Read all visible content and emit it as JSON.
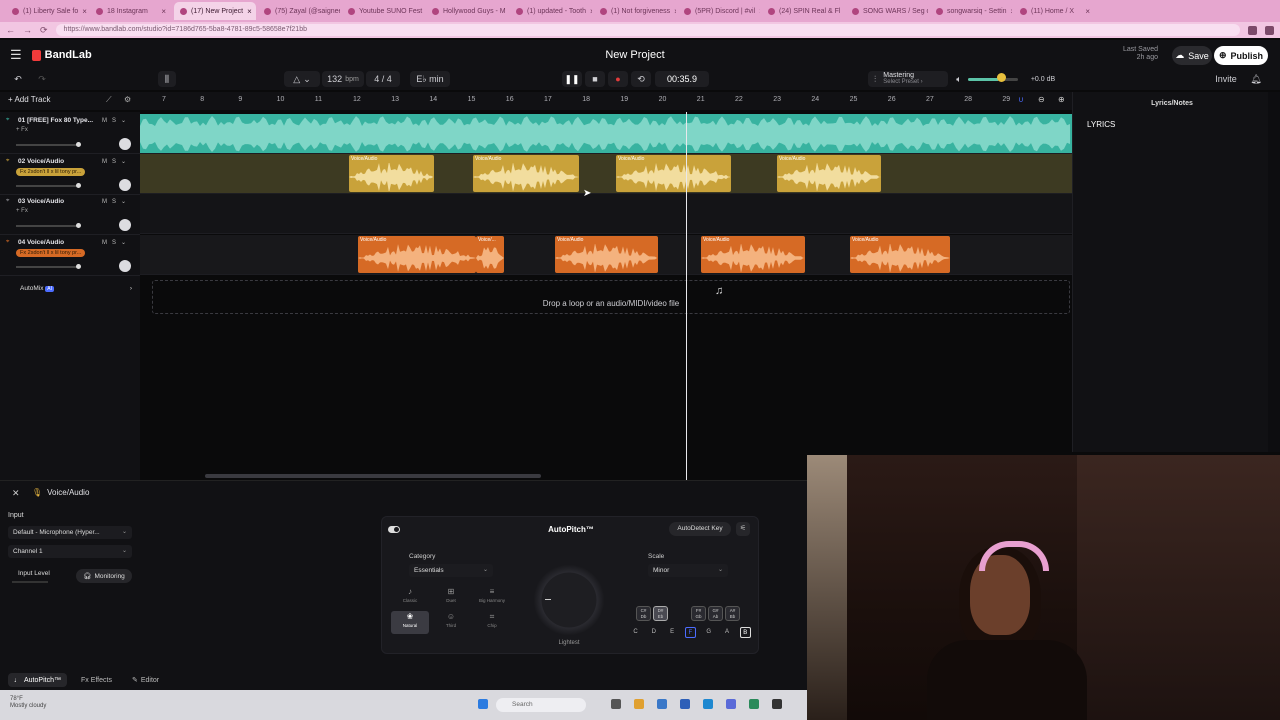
{
  "browser": {
    "tabs": [
      {
        "label": "(1) Liberty Sale fo"
      },
      {
        "label": "18 Instagram"
      },
      {
        "label": "(17) New Project",
        "active": true
      },
      {
        "label": "(75) Zayal (@saignee"
      },
      {
        "label": "Youtube SUNO Fest"
      },
      {
        "label": "Hollywood Guys - M"
      },
      {
        "label": "(1) updated - Tooth"
      },
      {
        "label": "(1) Not forgiveness"
      },
      {
        "label": "(5PR) Discord | #vil"
      },
      {
        "label": "(24) SPIN Real & Fl"
      },
      {
        "label": "SONG WARS / Seg of"
      },
      {
        "label": "songwarsiq - Settin"
      },
      {
        "label": "(11) Home / X"
      }
    ],
    "url": "https://www.bandlab.com/studio?id=7186d765-5ba8-4781-89c5-58658e7f21bb"
  },
  "app": {
    "brand": "BandLab",
    "project_title": "New Project",
    "last_saved_label": "Last Saved",
    "last_saved_value": "2h ago",
    "save_label": "Save",
    "publish_label": "Publish",
    "invite_label": "Invite"
  },
  "transport": {
    "bpm": "132",
    "bpm_unit": "bpm",
    "time_signature": "4 / 4",
    "key": "E♭ min",
    "time": "00:35.9",
    "mastering_label": "Mastering",
    "mastering_preset": "Select Preset ›",
    "volume_db": "+0.0 dB",
    "volume_level": 0.6
  },
  "ruler": {
    "add_track": "Add Track",
    "bars": [
      "7",
      "8",
      "9",
      "10",
      "11",
      "12",
      "13",
      "14",
      "15",
      "16",
      "17",
      "18",
      "19",
      "20",
      "21",
      "22",
      "23",
      "24",
      "25",
      "26",
      "27",
      "28",
      "29"
    ]
  },
  "tracks": [
    {
      "name": "01  [FREE] Fox 80 Type...",
      "fx": "+ Fx",
      "chip": "",
      "color": "#38b3a0"
    },
    {
      "name": "02  Voice/Audio",
      "fx": "",
      "chip": "Fx 2sdon't ll x lil tony pr...",
      "color": "#c9a23a"
    },
    {
      "name": "03  Voice/Audio",
      "fx": "+ Fx",
      "chip": "",
      "color": "#9a9aa0"
    },
    {
      "name": "04  Voice/Audio",
      "fx": "",
      "chip": "Fx 2sdon't ll x lil tony pr...",
      "color": "#d66a25"
    }
  ],
  "track_controls": {
    "mute": "M",
    "solo": "S"
  },
  "clips": {
    "yellow": [
      {
        "label": "Voice/Audio"
      },
      {
        "label": "Voice/Audio"
      },
      {
        "label": "Voice/Audio"
      },
      {
        "label": "Voice/Audio"
      }
    ],
    "orange": [
      {
        "label": "Voice/Audio"
      },
      {
        "label": "Voice/..."
      },
      {
        "label": "Voice/Audio"
      },
      {
        "label": "Voice/Audio"
      },
      {
        "label": "Voice/Audio"
      }
    ]
  },
  "automix": {
    "label": "AutoMix",
    "badge": "AI"
  },
  "dropzone": {
    "text": "Drop a loop or an audio/MIDI/video file"
  },
  "right_panel": {
    "title": "Lyrics/Notes",
    "section": "LYRICS"
  },
  "editor": {
    "title": "Voice/Audio",
    "input_label": "Input",
    "input_device": "Default - Microphone (Hyper...",
    "channel": "Channel 1",
    "input_level_label": "Input Level",
    "monitoring_label": "Monitoring",
    "autopitch": {
      "title": "AutoPitch™",
      "autodetect": "AutoDetect Key",
      "category_label": "Category",
      "category_value": "Essentials",
      "scale_label": "Scale",
      "scale_value": "Minor",
      "styles": [
        {
          "label": "Classic",
          "icon": "♪"
        },
        {
          "label": "Duet",
          "icon": "⊞"
        },
        {
          "label": "Big Harmony",
          "icon": "≡"
        },
        {
          "label": "Natural",
          "icon": "❀",
          "selected": true
        },
        {
          "label": "Third",
          "icon": "☺"
        },
        {
          "label": "Chip",
          "icon": "⌗"
        }
      ],
      "knob_label": "Lightest",
      "chords": [
        {
          "top": "C#",
          "bot": "Db"
        },
        {
          "top": "D#",
          "bot": "Eb",
          "selected": true
        },
        {
          "top": "F#",
          "bot": "Gb"
        },
        {
          "top": "G#",
          "bot": "Ab"
        },
        {
          "top": "A#",
          "bot": "Bb"
        }
      ],
      "notes": [
        "C",
        "D",
        "E",
        "F",
        "G",
        "A",
        "B"
      ]
    },
    "tabs": [
      {
        "label": "AutoPitch™",
        "active": true
      },
      {
        "label": "Fx  Effects"
      },
      {
        "label": "Editor"
      }
    ]
  },
  "taskbar": {
    "weather_temp": "78°F",
    "weather_desc": "Mostly cloudy",
    "search": "Search"
  }
}
